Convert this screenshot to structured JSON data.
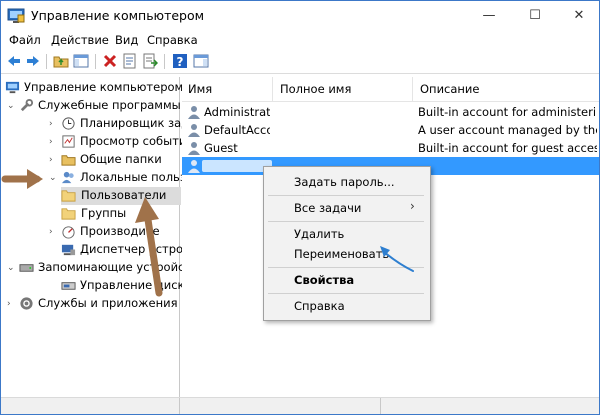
{
  "window": {
    "title": "Управление компьютером"
  },
  "menu": [
    "Файл",
    "Действие",
    "Вид",
    "Справка"
  ],
  "tree": {
    "root": "Управление компьютером (л",
    "system_tools": "Служебные программы",
    "task_scheduler": "Планировщик заданий",
    "event_viewer": "Просмотр событий",
    "shared_folders": "Общие папки",
    "local_users": "Локальные пользовате",
    "users": "Пользователи",
    "groups": "Группы",
    "performance": "Производите",
    "device_manager": "Диспетчер устройств",
    "storage": "Запоминающие устройс",
    "disk_management": "Управление дисками",
    "services": "Службы и приложения"
  },
  "columns": {
    "name": "Имя",
    "full_name": "Полное имя",
    "description": "Описание"
  },
  "rows": [
    {
      "name": "Administrator",
      "full_name": "",
      "description": "Built-in account for administering..."
    },
    {
      "name": "DefaultAcco...",
      "full_name": "",
      "description": "A user account managed by the s..."
    },
    {
      "name": "Guest",
      "full_name": "",
      "description": "Built-in account for guest access t..."
    }
  ],
  "context_menu": {
    "set_password": "Задать пароль...",
    "all_tasks": "Все задачи",
    "delete": "Удалить",
    "rename": "Переименовать",
    "properties": "Свойства",
    "help": "Справка"
  },
  "colors": {
    "selection": "#3399ff",
    "arrow_brown": "#a0724a",
    "arrow_blue": "#2e7fd0"
  }
}
